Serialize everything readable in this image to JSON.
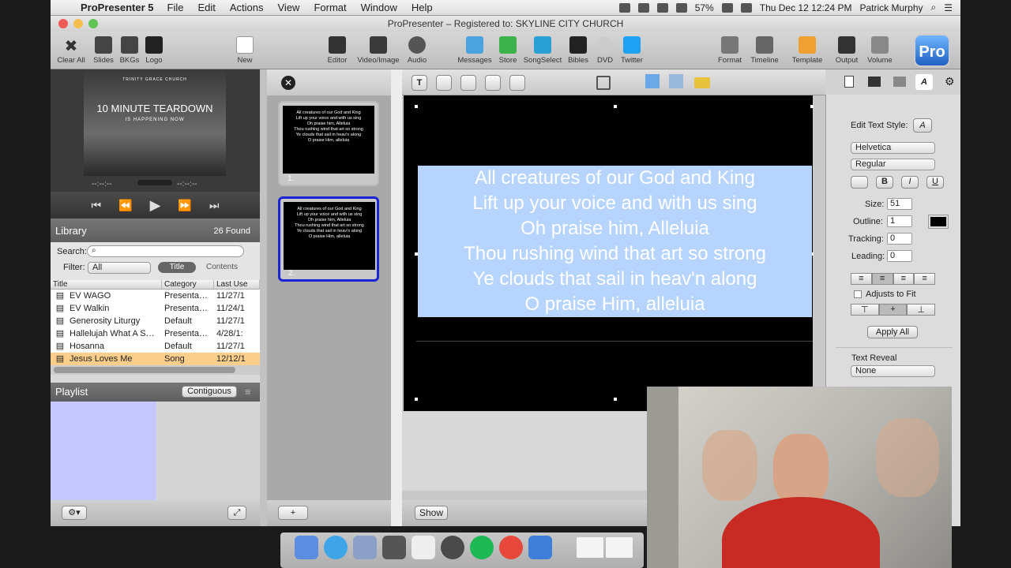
{
  "menubar": {
    "app": "ProPresenter 5",
    "items": [
      "File",
      "Edit",
      "Actions",
      "View",
      "Format",
      "Window",
      "Help"
    ],
    "battery": "57%",
    "clock": "Thu Dec 12  12:24 PM",
    "user": "Patrick Murphy"
  },
  "window": {
    "title": "ProPresenter – Registered to: SKYLINE CITY CHURCH"
  },
  "toolbar": {
    "clear_all": "Clear All",
    "slides": "Slides",
    "bkgs": "BKGs",
    "logo": "Logo",
    "new": "New",
    "editor": "Editor",
    "video_image": "Video/Image",
    "audio": "Audio",
    "messages": "Messages",
    "store": "Store",
    "songselect": "SongSelect",
    "bibles": "Bibles",
    "dvd": "DVD",
    "twitter": "Twitter",
    "format": "Format",
    "timeline": "Timeline",
    "template": "Template",
    "output": "Output",
    "volume": "Volume",
    "pro_badge": "Pro"
  },
  "preview": {
    "church": "TRINITY GRACE CHURCH",
    "headline": "10 MINUTE TEARDOWN",
    "sub": "IS HAPPENING NOW",
    "timecode_left": "--:--:--",
    "timecode_right": "--:--:--"
  },
  "library": {
    "title": "Library",
    "count": "26 Found",
    "search_label": "Search:",
    "filter_label": "Filter:",
    "filter_value": "All",
    "tab_title": "Title",
    "tab_contents": "Contents",
    "columns": [
      "Title",
      "Category",
      "Last Use"
    ],
    "rows": [
      {
        "title": "EV WAGO",
        "category": "Presenta…",
        "last": "11/27/1"
      },
      {
        "title": "EV Walkin",
        "category": "Presenta…",
        "last": "11/24/1"
      },
      {
        "title": "Generosity Liturgy",
        "category": "Default",
        "last": "11/27/1"
      },
      {
        "title": "Hallelujah What A S…",
        "category": "Presenta…",
        "last": "4/28/1:"
      },
      {
        "title": "Hosanna",
        "category": "Default",
        "last": "11/27/1"
      },
      {
        "title": "Jesus Loves Me",
        "category": "Song",
        "last": "12/12/1"
      }
    ]
  },
  "playlist": {
    "title": "Playlist",
    "mode": "Contiguous"
  },
  "slides": [
    {
      "num": "1.",
      "lines": [
        "All creatures of our God and King",
        "Lift up your voice and with us sing",
        "Oh praise him,  Alleluia",
        "Thou rushing wind that art so strong",
        "Ye clouds that sail in heav'n along",
        "O praise Him, alleluia"
      ]
    },
    {
      "num": "2.",
      "lines": [
        "All creatures of our God and King",
        "Lift up your voice and with us sing",
        "Oh praise him,  Alleluia",
        "Thou rushing wind that art so strong",
        "Ye clouds that sail in heav'n along",
        "O praise Him, alleluia"
      ]
    }
  ],
  "editor": {
    "lines": [
      "All creatures of our God and King",
      "Lift up your voice and with us sing",
      "Oh praise him,  Alleluia",
      "Thou rushing wind that art so strong",
      "Ye clouds that sail in heav'n along",
      "O praise Him, alleluia"
    ],
    "show_button": "Show",
    "add_button": "+"
  },
  "inspector": {
    "edit_text_style": "Edit Text Style:",
    "font": "Helvetica",
    "weight": "Regular",
    "size_label": "Size:",
    "size": "51",
    "outline_label": "Outline:",
    "outline": "1",
    "tracking_label": "Tracking:",
    "tracking": "0",
    "leading_label": "Leading:",
    "leading": "0",
    "adjusts_to_fit": "Adjusts to Fit",
    "apply_all": "Apply All",
    "text_reveal": "Text Reveal",
    "reveal_value": "None",
    "bold": "B",
    "italic": "I",
    "underline": "U"
  }
}
